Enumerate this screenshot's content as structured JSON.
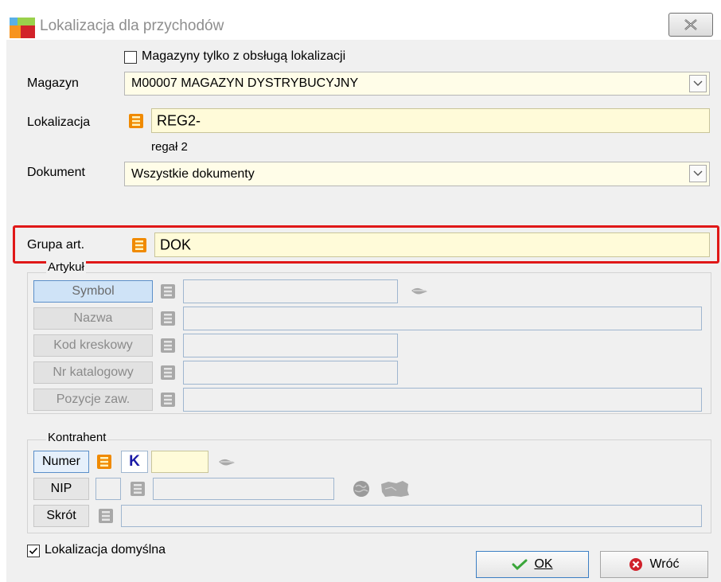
{
  "window": {
    "title": "Lokalizacja dla przychodów"
  },
  "form": {
    "only_loc_warehouses_label": "Magazyny tylko z obsługą lokalizacji",
    "only_loc_warehouses_checked": false,
    "magazyn_label": "Magazyn",
    "magazyn_value": "M00007 MAGAZYN DYSTRYBUCYJNY",
    "lokalizacja_label": "Lokalizacja",
    "lokalizacja_value": "REG2-",
    "lokalizacja_desc": "regał 2",
    "dokument_label": "Dokument",
    "dokument_value": "Wszystkie dokumenty",
    "grupa_label": "Grupa art.",
    "grupa_value": "DOK"
  },
  "artykul": {
    "title": "Artykuł",
    "buttons": [
      "Symbol",
      "Nazwa",
      "Kod kreskowy",
      "Nr katalogowy",
      "Pozycje zaw."
    ]
  },
  "kontrahent": {
    "title": "Kontrahent",
    "numer_label": "Numer",
    "k_label": "K",
    "nip_label": "NIP",
    "skrot_label": "Skrót"
  },
  "footer": {
    "default_loc_label": "Lokalizacja domyślna",
    "default_loc_checked": true,
    "ok_label": "OK",
    "back_label": "Wróć"
  },
  "colors": {
    "highlight": "#e01818",
    "field_bg": "#fffde8",
    "accent": "#1a1aa6",
    "list_icon": "#f08a00"
  },
  "icons": {
    "app": "app-logo-icon",
    "close": "close-icon",
    "list": "list-icon",
    "dropdown": "chevron-down-icon",
    "ok": "checkmark-icon",
    "back": "cancel-icon",
    "eraser": "eraser-icon",
    "globe": "globe-icon",
    "poland": "poland-map-icon"
  }
}
